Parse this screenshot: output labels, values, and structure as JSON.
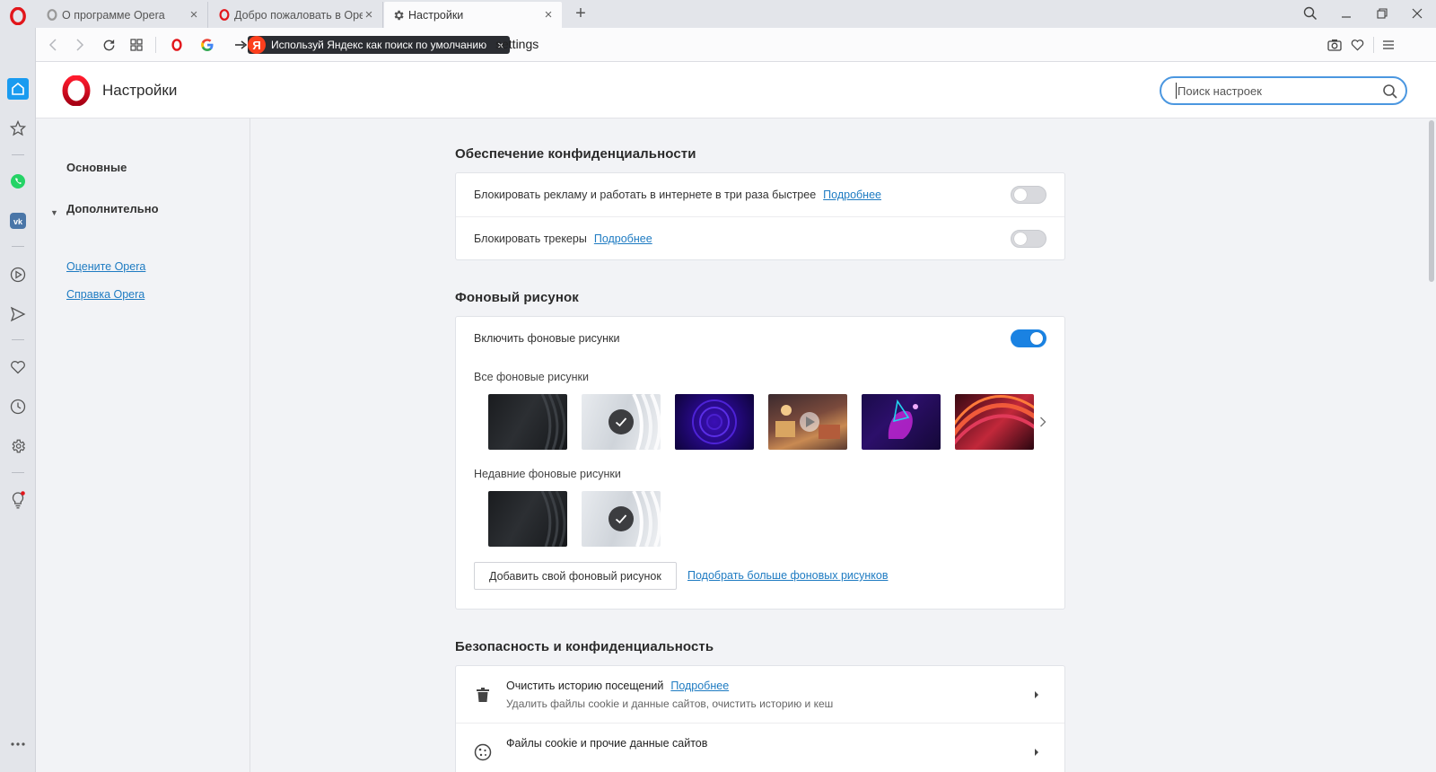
{
  "tabs": [
    {
      "title": "О программе Opera",
      "active": false
    },
    {
      "title": "Добро пожаловать в Opera",
      "active": false
    },
    {
      "title": "Настройки",
      "active": true
    }
  ],
  "tabbar": {
    "new_tab": "+"
  },
  "addressbar": {
    "promo_badge": "Я",
    "promo_text": "Используй Яндекс как поиск по умолчанию",
    "promo_close": "×",
    "url": "settings"
  },
  "header": {
    "title": "Настройки",
    "search_placeholder": "Поиск настроек"
  },
  "nav": {
    "basic": "Основные",
    "advanced": "Дополнительно",
    "rate": "Оцените Opera",
    "help": "Справка Opera"
  },
  "privacy": {
    "title": "Обеспечение конфиденциальности",
    "rows": [
      {
        "label": "Блокировать рекламу и работать в интернете в три раза быстрее",
        "link": "Подробнее",
        "enabled": false
      },
      {
        "label": "Блокировать трекеры",
        "link": "Подробнее",
        "enabled": false
      }
    ]
  },
  "wallpaper": {
    "title": "Фоновый рисунок",
    "enable_label": "Включить фоновые рисунки",
    "enabled": true,
    "all_label": "Все фоновые рисунки",
    "recent_label": "Недавние фоновые рисунки",
    "add_button": "Добавить свой фоновый рисунок",
    "more_link": "Подобрать больше фоновых рисунков"
  },
  "security": {
    "title": "Безопасность и конфиденциальность",
    "rows": [
      {
        "title": "Очистить историю посещений",
        "link": "Подробнее",
        "desc": "Удалить файлы cookie и данные сайтов, очистить историю и кеш"
      },
      {
        "title": "Файлы cookie и прочие данные сайтов"
      }
    ]
  },
  "colors": {
    "accent": "#1a82e2",
    "opera_red": "#e2161b",
    "link": "#1e7bc2"
  }
}
